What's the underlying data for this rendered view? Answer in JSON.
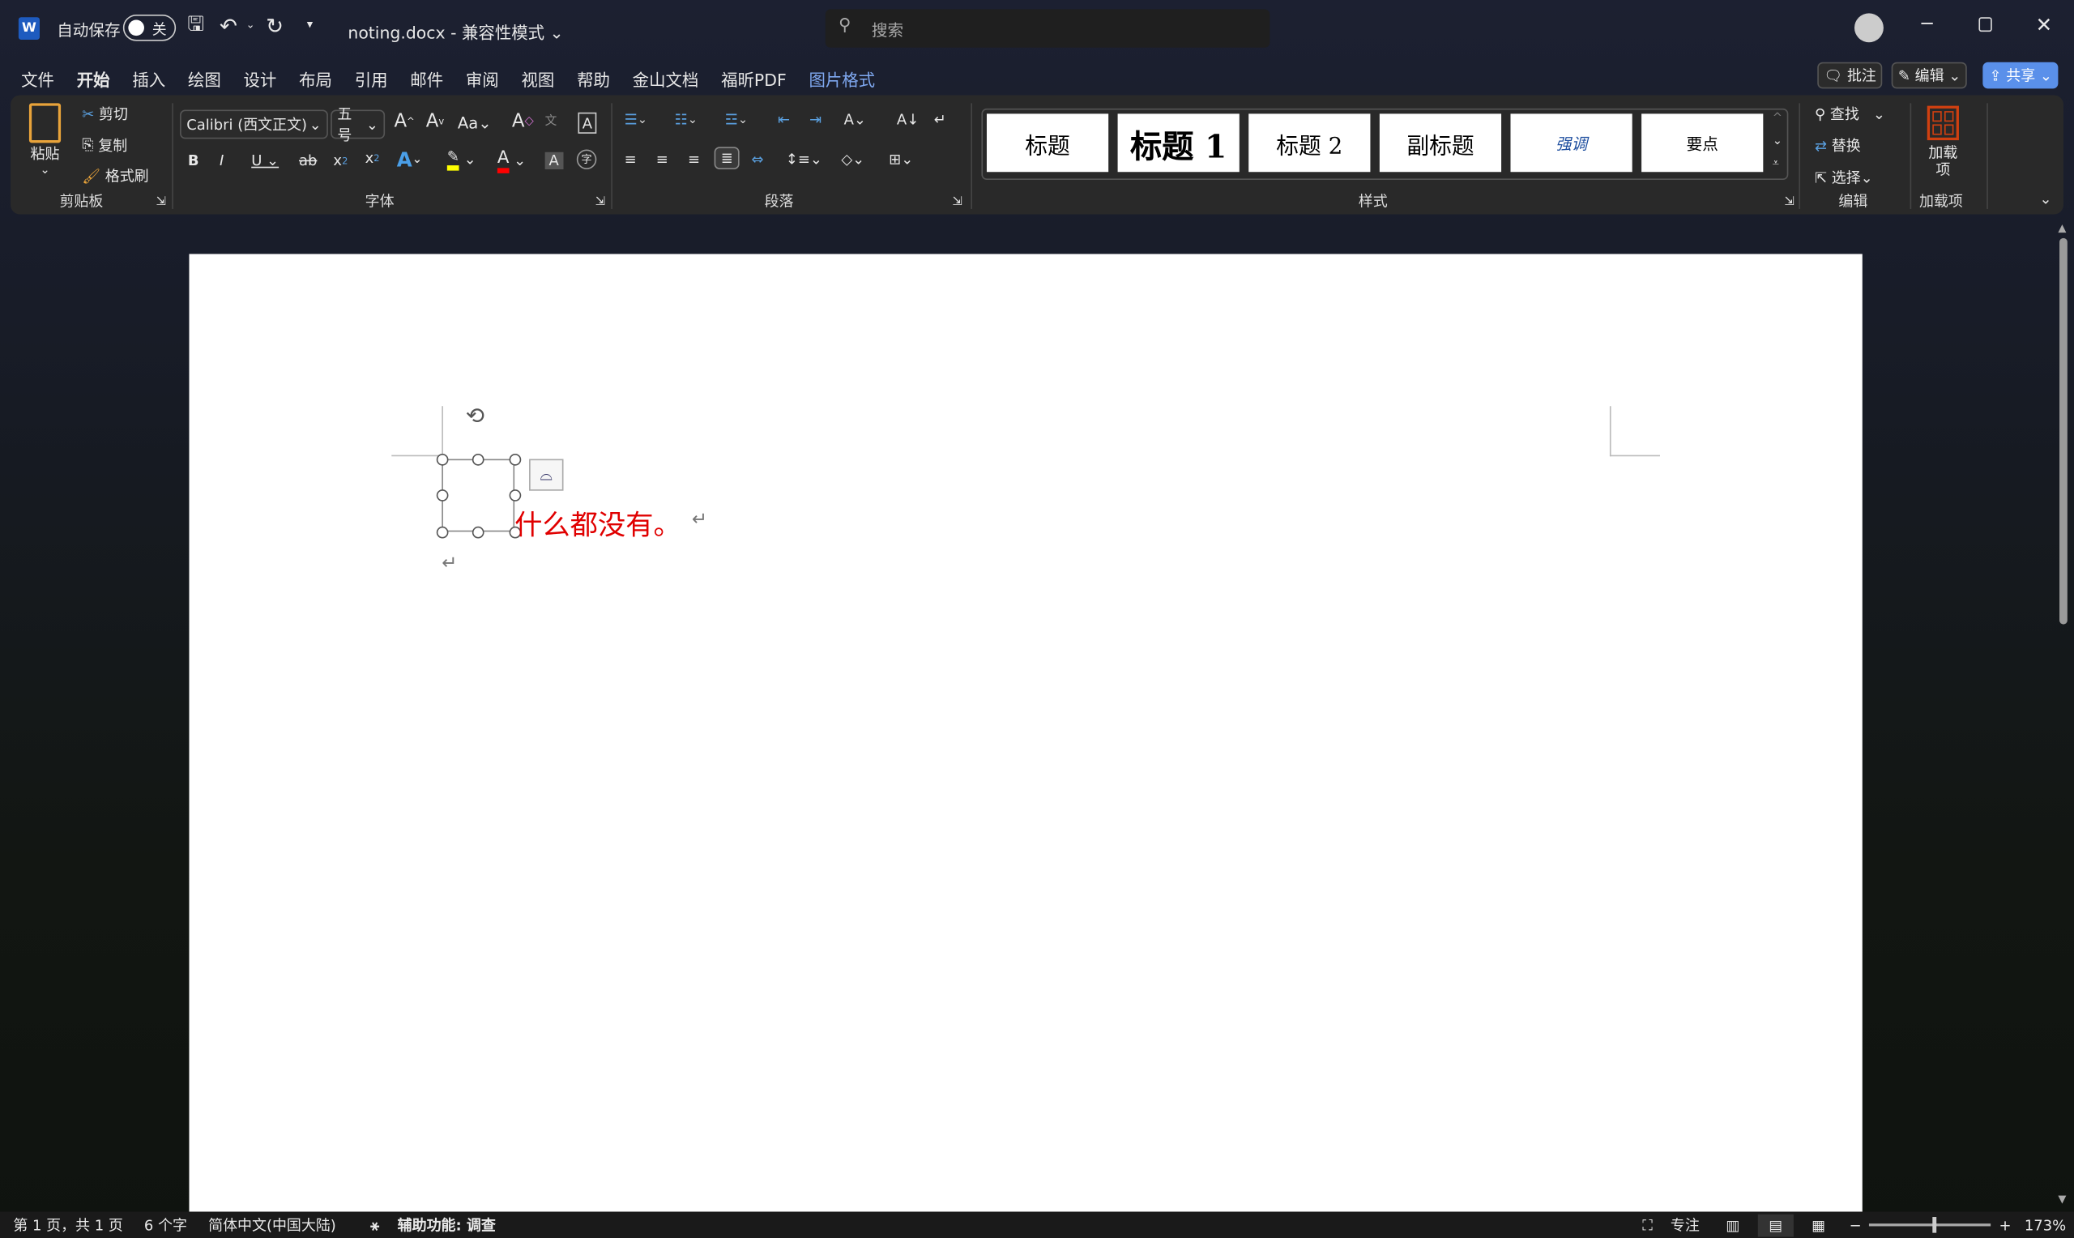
{
  "titlebar": {
    "autosave_label": "自动保存",
    "autosave_state": "关",
    "filename": "noting.docx",
    "separator": "-",
    "mode": "兼容性模式",
    "search_placeholder": "搜索"
  },
  "tabs": [
    "文件",
    "开始",
    "插入",
    "绘图",
    "设计",
    "布局",
    "引用",
    "邮件",
    "审阅",
    "视图",
    "帮助",
    "金山文档",
    "福昕PDF",
    "图片格式"
  ],
  "active_tab": "开始",
  "right_buttons": {
    "comment": "批注",
    "edit": "编辑",
    "share": "共享"
  },
  "clipboard": {
    "paste": "粘贴",
    "cut": "剪切",
    "copy": "复制",
    "format_painter": "格式刷",
    "label": "剪贴板"
  },
  "font": {
    "name": "Calibri (西文正文)",
    "size": "五号",
    "label": "字体",
    "highlight_color": "#ffff00",
    "font_color": "#ff0000"
  },
  "paragraph": {
    "label": "段落"
  },
  "styles": {
    "items": [
      "标题",
      "标题 1",
      "标题 2",
      "副标题",
      "强调",
      "要点"
    ],
    "label": "样式"
  },
  "editing": {
    "find": "查找",
    "replace": "替换",
    "select": "选择",
    "label": "编辑"
  },
  "addins": {
    "button": "加载项",
    "label": "加载项"
  },
  "document": {
    "text": "什么都没有。",
    "text_color": "#e00000"
  },
  "statusbar": {
    "page": "第 1 页，共 1 页",
    "words": "6 个字",
    "language": "简体中文(中国大陆)",
    "accessibility": "辅助功能: 调查",
    "focus": "专注",
    "zoom": "173%"
  }
}
